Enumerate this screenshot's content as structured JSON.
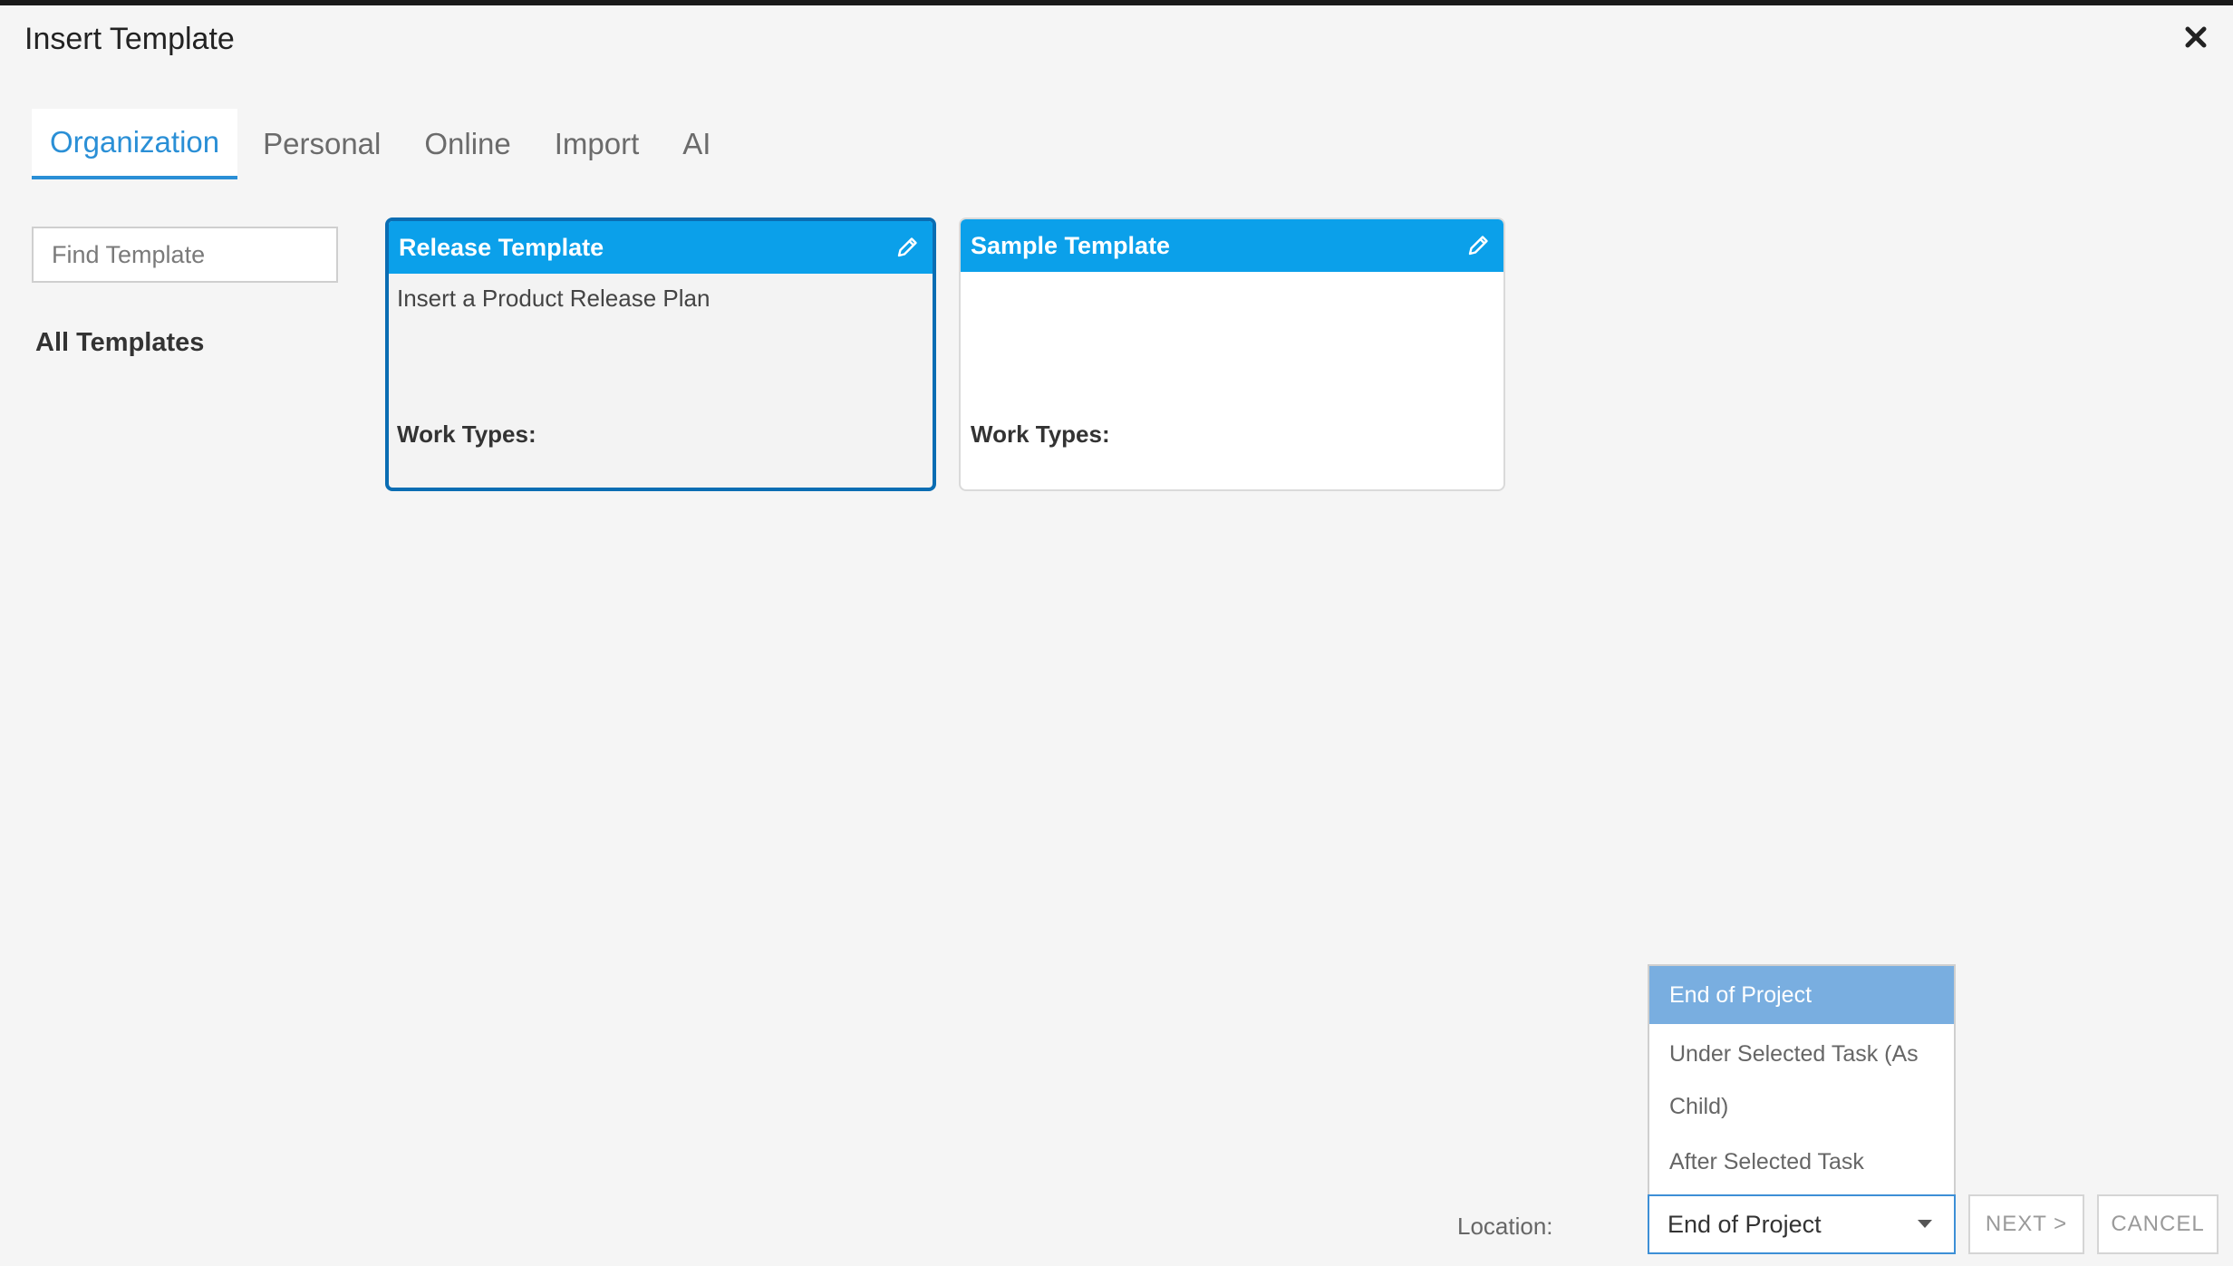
{
  "dialog": {
    "title": "Insert Template"
  },
  "tabs": [
    {
      "label": "Organization",
      "active": true
    },
    {
      "label": "Personal",
      "active": false
    },
    {
      "label": "Online",
      "active": false
    },
    {
      "label": "Import",
      "active": false
    },
    {
      "label": "AI",
      "active": false
    }
  ],
  "search": {
    "placeholder": "Find Template",
    "value": ""
  },
  "sidebar": {
    "all_templates_label": "All Templates"
  },
  "templates": [
    {
      "title": "Release Template",
      "description": "Insert a Product Release Plan",
      "work_types_label": "Work Types:",
      "selected": true,
      "icon": "pencil-icon"
    },
    {
      "title": "Sample Template",
      "description": "",
      "work_types_label": "Work Types:",
      "selected": false,
      "icon": "pencil-icon"
    }
  ],
  "location": {
    "label": "Location:",
    "value": "End of Project",
    "options": [
      {
        "line1": "End of Project",
        "line2": "",
        "selected": true
      },
      {
        "line1": "Under Selected Task (As",
        "line2": "Child)",
        "selected": false
      },
      {
        "line1": "After Selected Task",
        "line2": "",
        "selected": false
      }
    ]
  },
  "buttons": {
    "next": "NEXT >",
    "cancel": "CANCEL"
  },
  "colors": {
    "accent": "#2a8fd6",
    "card_header": "#0ba0ea",
    "selected_border": "#0a6db3",
    "dropdown_highlight": "#79aee0",
    "background": "#f5f5f5"
  }
}
